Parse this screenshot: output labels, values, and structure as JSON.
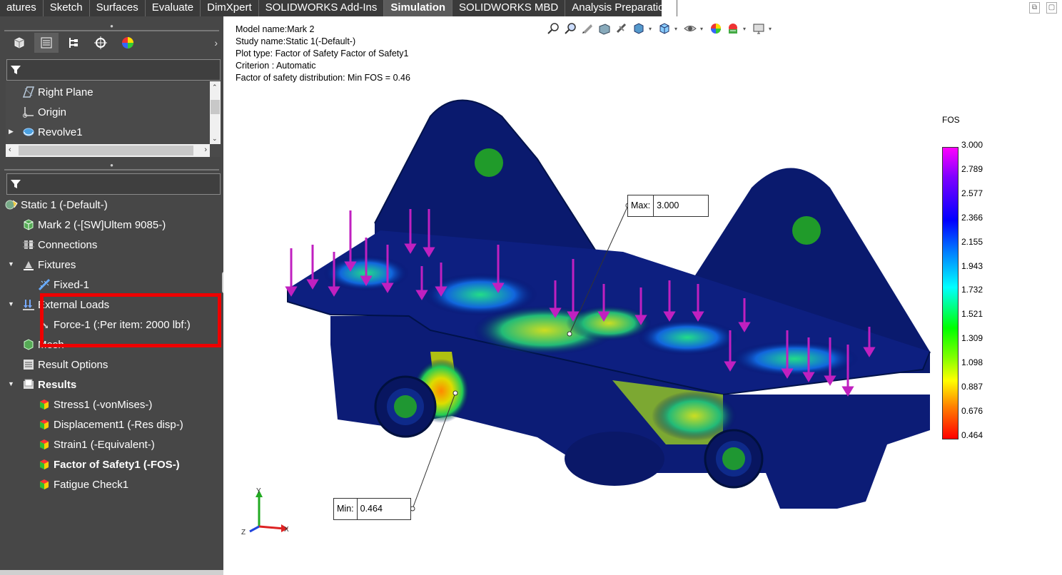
{
  "tabs": [
    "atures",
    "Sketch",
    "Surfaces",
    "Evaluate",
    "DimXpert",
    "SOLIDWORKS Add-Ins",
    "Simulation",
    "SOLIDWORKS MBD",
    "Analysis Preparation"
  ],
  "active_tab": "Simulation",
  "feature_tree": {
    "items": [
      "Right Plane",
      "Origin",
      "Revolve1"
    ]
  },
  "sim_tree": {
    "study": "Static 1 (-Default-)",
    "part": "Mark 2 (-[SW]Ultem 9085-)",
    "connections": "Connections",
    "fixtures": "Fixtures",
    "fixed": "Fixed-1",
    "external_loads": "External Loads",
    "force": "Force-1 (:Per item: 2000 lbf:)",
    "mesh": "Mesh",
    "result_options": "Result Options",
    "results": "Results",
    "result_items": [
      "Stress1 (-vonMises-)",
      "Displacement1 (-Res disp-)",
      "Strain1 (-Equivalent-)",
      "Factor of Safety1 (-FOS-)",
      "Fatigue Check1"
    ]
  },
  "plot_info": {
    "model_name": "Model name:Mark 2",
    "study_name": "Study name:Static 1(-Default-)",
    "plot_type": "Plot type: Factor of Safety Factor of Safety1",
    "criterion": "Criterion : Automatic",
    "distribution": "Factor of safety distribution: Min FOS =  0.46"
  },
  "legend": {
    "title": "FOS",
    "ticks": [
      "3.000",
      "2.789",
      "2.577",
      "2.366",
      "2.155",
      "1.943",
      "1.732",
      "1.521",
      "1.309",
      "1.098",
      "0.887",
      "0.676",
      "0.464"
    ]
  },
  "callouts": {
    "max_label": "Max:",
    "max_value": "3.000",
    "min_label": "Min:",
    "min_value": "0.464"
  },
  "triad": {
    "y": "Y",
    "x": "X",
    "z": "Z"
  },
  "toolbar_icons": [
    "zoom-to-fit-icon",
    "zoom-area-icon",
    "previous-view-icon",
    "section-view-icon",
    "view-orientation-icon",
    "display-style-icon",
    "hide-show-icon",
    "edit-appearance-icon",
    "apply-scene-icon",
    "view-settings-icon"
  ],
  "colors": {
    "highlight": "#ee0000",
    "panel": "#474747",
    "load_arrow": "#c020c0",
    "fixture": "#22aa22"
  }
}
